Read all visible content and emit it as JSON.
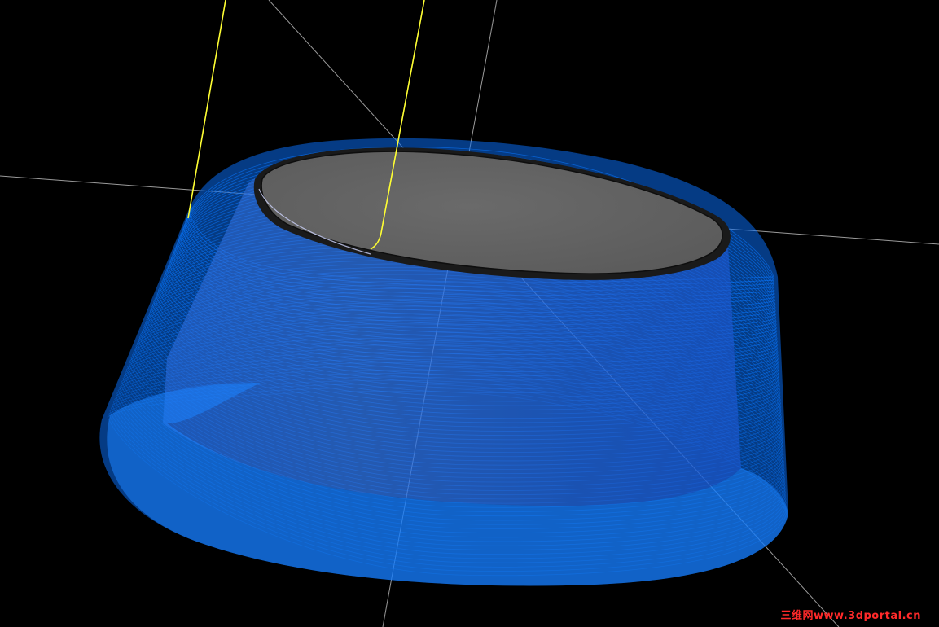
{
  "viewport": {
    "background": "#000000",
    "view": "toolpath-3d-preview"
  },
  "model": {
    "top_face_color": "#666666",
    "wall_color": "#c8c8cc",
    "edge_color": "#101010"
  },
  "toolpath": {
    "color": "#0a78ff",
    "pass_style": "dense-contour-passes"
  },
  "lead_moves": {
    "color": "#ffff33"
  },
  "axes": {
    "color": "#9a9a9a"
  },
  "watermark": {
    "text": "三维网www.3dportal.cn",
    "color": "#ff2a2a"
  }
}
